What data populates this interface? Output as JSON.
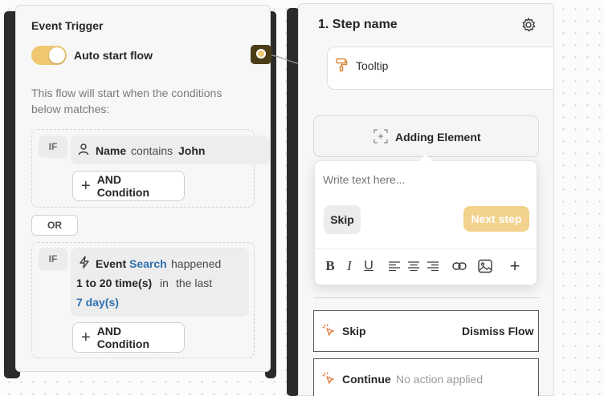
{
  "trigger_panel": {
    "title": "Event Trigger",
    "toggle_label": "Auto start flow",
    "toggle_on": true,
    "description": "This flow will start when the conditions below matches:",
    "group1": {
      "if_label": "IF",
      "condition": {
        "field": "Name",
        "operator": "contains",
        "value": "John"
      },
      "and_button": "AND Condition"
    },
    "or_label": "OR",
    "group2": {
      "if_label": "IF",
      "condition": {
        "prefix": "Event",
        "event": "Search",
        "verb": "happened",
        "range": "1 to 20 time(s)",
        "in": "in",
        "the_last": "the last",
        "period": "7 day(s)"
      },
      "and_button": "AND Condition"
    }
  },
  "step_panel": {
    "title": "1. Step name",
    "tooltip_label": "Tooltip",
    "adding_element": "Adding Element",
    "editor": {
      "placeholder": "Write text here...",
      "skip_button": "Skip",
      "next_button": "Next step"
    },
    "toolbar": [
      "bold",
      "italic",
      "underline",
      "align-left",
      "align-center",
      "align-right",
      "link",
      "image",
      "add"
    ],
    "actions": [
      {
        "label": "Skip",
        "value": "Dismiss Flow"
      },
      {
        "label": "Continue",
        "value": "No action applied"
      }
    ]
  },
  "colors": {
    "accent": "#f0c871",
    "link": "#2f6fb0",
    "dark": "#2b2b2b"
  }
}
